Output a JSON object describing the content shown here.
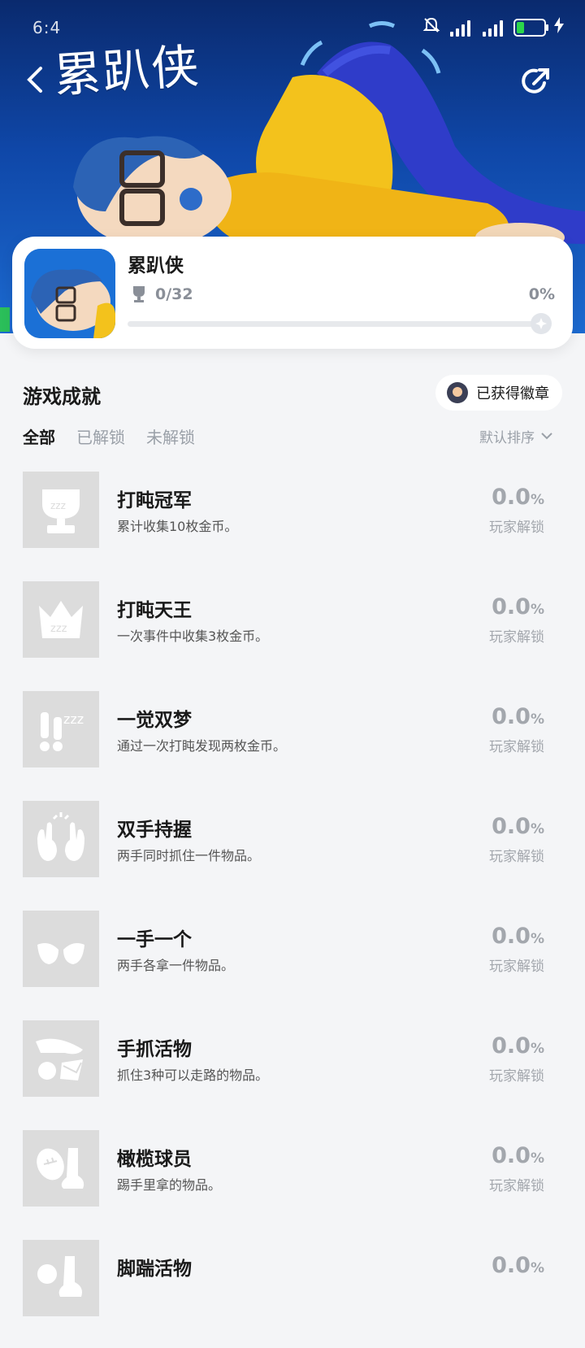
{
  "status": {
    "time": "6:4",
    "battery": "6"
  },
  "hero": {
    "logo": "累趴侠"
  },
  "game": {
    "name": "累趴侠",
    "trophy_count": "0/32",
    "percent": "0%",
    "progress": 0
  },
  "section": {
    "title": "游戏成就",
    "badge_button": "已获得徽章"
  },
  "tabs": [
    "全部",
    "已解锁",
    "未解锁"
  ],
  "sort": {
    "label": "默认排序"
  },
  "achievements": [
    {
      "name": "打盹冠军",
      "desc": "累计收集10枚金币。",
      "rate": "0.0",
      "unit": "%",
      "rate_label": "玩家解锁",
      "icon": "trophy-zzz-icon"
    },
    {
      "name": "打盹天王",
      "desc": "一次事件中收集3枚金币。",
      "rate": "0.0",
      "unit": "%",
      "rate_label": "玩家解锁",
      "icon": "crown-zzz-icon"
    },
    {
      "name": "一觉双梦",
      "desc": "通过一次打盹发现两枚金币。",
      "rate": "0.0",
      "unit": "%",
      "rate_label": "玩家解锁",
      "icon": "exclaim-zzz-icon"
    },
    {
      "name": "双手持握",
      "desc": "两手同时抓住一件物品。",
      "rate": "0.0",
      "unit": "%",
      "rate_label": "玩家解锁",
      "icon": "two-hands-icon"
    },
    {
      "name": "一手一个",
      "desc": "两手各拿一件物品。",
      "rate": "0.0",
      "unit": "%",
      "rate_label": "玩家解锁",
      "icon": "open-hands-icon"
    },
    {
      "name": "手抓活物",
      "desc": "抓住3种可以走路的物品。",
      "rate": "0.0",
      "unit": "%",
      "rate_label": "玩家解锁",
      "icon": "hand-grab-icon"
    },
    {
      "name": "橄榄球员",
      "desc": "踢手里拿的物品。",
      "rate": "0.0",
      "unit": "%",
      "rate_label": "玩家解锁",
      "icon": "football-foot-icon"
    },
    {
      "name": "脚踹活物",
      "desc": "",
      "rate": "0.0",
      "unit": "%",
      "rate_label": "",
      "icon": "foot-kick-icon"
    }
  ]
}
